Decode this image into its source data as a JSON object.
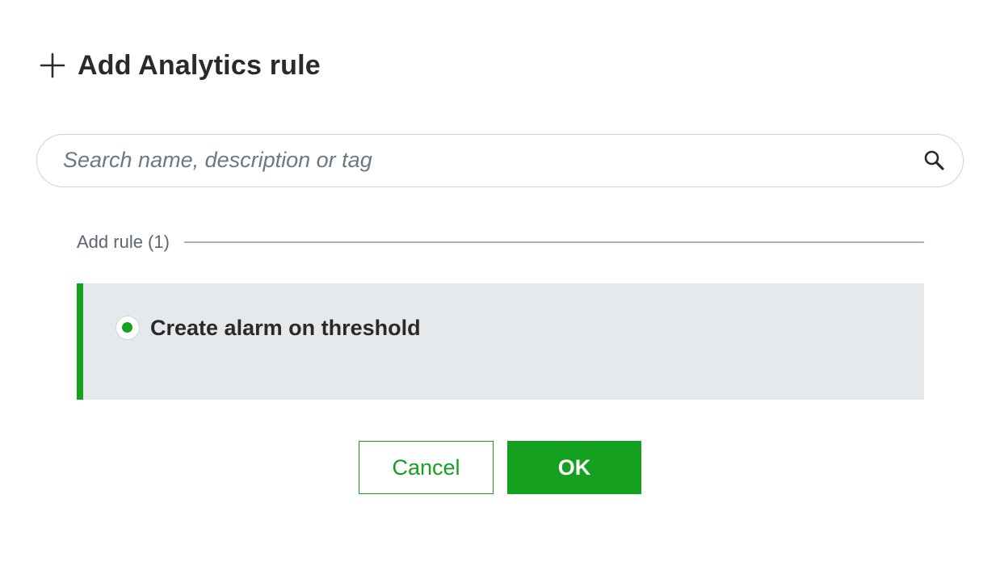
{
  "dialog": {
    "title": "Add Analytics rule",
    "icon": "plus-icon"
  },
  "search": {
    "placeholder": "Search name, description or tag",
    "value": "",
    "icon": "search-icon"
  },
  "section": {
    "label": "Add rule (1)"
  },
  "rules": [
    {
      "label": "Create alarm on threshold",
      "selected": true
    }
  ],
  "buttons": {
    "cancel_label": "Cancel",
    "ok_label": "OK"
  },
  "colors": {
    "accent": "#16a01f",
    "selected_background": "#e6e9ec",
    "text": "#2a2a2a",
    "muted_text": "#5c6670"
  }
}
